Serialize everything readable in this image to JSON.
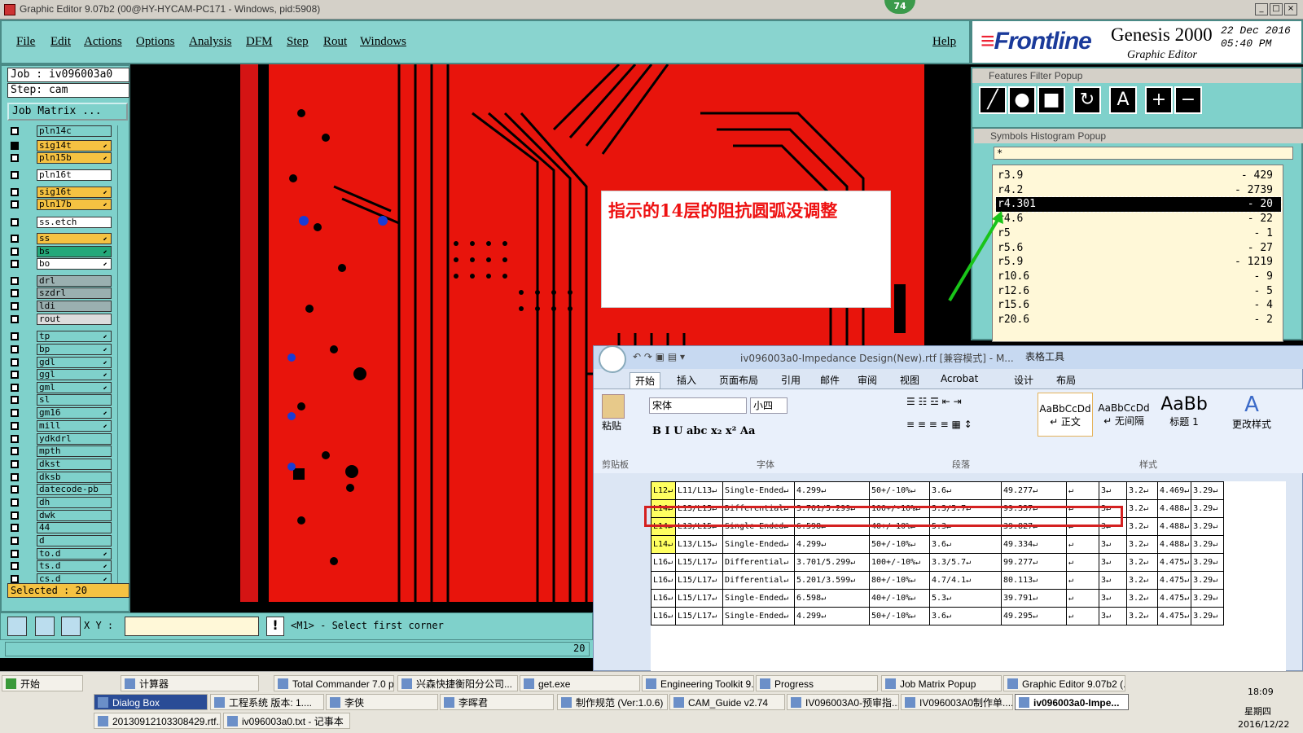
{
  "window": {
    "title": "Graphic Editor 9.07b2 (00@HY-HYCAM-PC171 - Windows, pid:5908)",
    "badge": "74"
  },
  "menu": {
    "items": [
      "File",
      "Edit",
      "Actions",
      "Options",
      "Analysis",
      "DFM",
      "Step",
      "Rout",
      "Windows"
    ],
    "help": "Help"
  },
  "brand": {
    "logo": "Frontline",
    "product": "Genesis 2000",
    "subtitle": "Graphic Editor",
    "date": "22 Dec 2016",
    "time": "05:40 PM"
  },
  "job": {
    "job_label": "Job  :  iv096003a0",
    "step_label": "Step:  cam",
    "matrix_button": "Job Matrix ..."
  },
  "layers": [
    {
      "name": "pln14c",
      "color": "#7fd1cb"
    },
    {
      "name": "sig14t",
      "color": "#f5c242",
      "arrow": true,
      "active": true
    },
    {
      "name": "pln15b",
      "color": "#f5c242",
      "arrow": true
    },
    {
      "name": "pln16t",
      "color": "#ffffff"
    },
    {
      "name": "sig16t",
      "color": "#f5c242",
      "arrow": true
    },
    {
      "name": "pln17b",
      "color": "#f5c242",
      "arrow": true
    },
    {
      "name": "ss.etch",
      "color": "#ffffff"
    },
    {
      "name": "ss",
      "color": "#f5c242",
      "arrow": true
    },
    {
      "name": "bs",
      "color": "#24a87a",
      "arrow": true
    },
    {
      "name": "bo",
      "color": "#ffffff",
      "arrow": true
    },
    {
      "name": "drl",
      "color": "#9ab0b0"
    },
    {
      "name": "szdrl",
      "color": "#9ab0b0"
    },
    {
      "name": "ldi",
      "color": "#9ab0b0"
    },
    {
      "name": "rout",
      "color": "#dddddd"
    },
    {
      "name": "tp",
      "color": "#7fd1cb",
      "arrow": true
    },
    {
      "name": "bp",
      "color": "#7fd1cb",
      "arrow": true
    },
    {
      "name": "gdl",
      "color": "#7fd1cb",
      "arrow": true
    },
    {
      "name": "ggl",
      "color": "#7fd1cb",
      "arrow": true
    },
    {
      "name": "gml",
      "color": "#7fd1cb",
      "arrow": true
    },
    {
      "name": "sl",
      "color": "#7fd1cb"
    },
    {
      "name": "gm16",
      "color": "#7fd1cb",
      "arrow": true
    },
    {
      "name": "mill",
      "color": "#7fd1cb",
      "arrow": true
    },
    {
      "name": "ydkdrl",
      "color": "#7fd1cb"
    },
    {
      "name": "mpth",
      "color": "#7fd1cb"
    },
    {
      "name": "dkst",
      "color": "#7fd1cb"
    },
    {
      "name": "dksb",
      "color": "#7fd1cb"
    },
    {
      "name": "datecode-pb",
      "color": "#7fd1cb"
    },
    {
      "name": "dh",
      "color": "#7fd1cb"
    },
    {
      "name": "dwk",
      "color": "#7fd1cb"
    },
    {
      "name": "44",
      "color": "#7fd1cb"
    },
    {
      "name": "d",
      "color": "#7fd1cb"
    },
    {
      "name": "to.d",
      "color": "#7fd1cb",
      "arrow": true
    },
    {
      "name": "ts.d",
      "color": "#7fd1cb",
      "arrow": true
    },
    {
      "name": "cs.d",
      "color": "#7fd1cb",
      "arrow": true
    }
  ],
  "selected": "Selected : 20",
  "command": {
    "xy_label": "X Y :",
    "prompt": "<M1> - Select first corner",
    "status_count": "20"
  },
  "features_popup": {
    "title": "Features Filter Popup"
  },
  "symbols_popup": {
    "title": "Symbols Histogram Popup",
    "filter": "*",
    "rows": [
      {
        "name": "r3.9",
        "count": "- 429"
      },
      {
        "name": "r4.2",
        "count": "- 2739"
      },
      {
        "name": "r4.301",
        "count": "- 20",
        "selected": true
      },
      {
        "name": "r4.6",
        "count": "- 22"
      },
      {
        "name": "r5",
        "count": "- 1"
      },
      {
        "name": "r5.6",
        "count": "- 27"
      },
      {
        "name": "r5.9",
        "count": "- 1219"
      },
      {
        "name": "r10.6",
        "count": "- 9"
      },
      {
        "name": "r12.6",
        "count": "- 5"
      },
      {
        "name": "r15.6",
        "count": "- 4"
      },
      {
        "name": "r20.6",
        "count": "- 2"
      }
    ]
  },
  "annotation": "指示的14层的阻抗圆弧没调整",
  "word": {
    "title": "iv096003a0-Impedance Design(New).rtf [兼容模式] - M...",
    "context_tab": "表格工具",
    "tabs": [
      "开始",
      "插入",
      "页面布局",
      "引用",
      "邮件",
      "审阅",
      "视图",
      "Acrobat",
      "设计",
      "布局"
    ],
    "font_name": "宋体",
    "font_size": "小四",
    "groups": [
      "剪贴板",
      "字体",
      "段落",
      "样式"
    ],
    "paste": "粘贴",
    "styles": [
      {
        "sample": "AaBbCcDd",
        "label": "↵ 正文"
      },
      {
        "sample": "AaBbCcDd",
        "label": "↵ 无间隔"
      },
      {
        "sample": "AaBb",
        "label": "标题 1"
      }
    ],
    "change_styles": "更改样式",
    "table": [
      [
        "L12↵",
        "L11/L13↵",
        "Single-Ended↵",
        "4.299↵",
        "50+/-10%↵",
        "3.6↵",
        "49.277↵",
        "↵",
        "3↵",
        "3.2↵",
        "4.469↵",
        "3.29↵"
      ],
      [
        "L14↵",
        "L13/L15↵",
        "Differential↵",
        "3.701/5.299↵",
        "100+/-10%↵",
        "3.3/5.7↵",
        "99.337↵",
        "↵",
        "3↵",
        "3.2↵",
        "4.488↵",
        "3.29↵"
      ],
      [
        "L14↵",
        "L13/L15↵",
        "Single-Ended↵",
        "6.598↵",
        "40+/-10%↵",
        "5.3↵",
        "39.827↵",
        "↵",
        "3↵",
        "3.2↵",
        "4.488↵",
        "3.29↵"
      ],
      [
        "L14↵",
        "L13/L15↵",
        "Single-Ended↵",
        "4.299↵",
        "50+/-10%↵",
        "3.6↵",
        "49.334↵",
        "↵",
        "3↵",
        "3.2↵",
        "4.488↵",
        "3.29↵"
      ],
      [
        "L16↵",
        "L15/L17↵",
        "Differential↵",
        "3.701/5.299↵",
        "100+/-10%↵",
        "3.3/5.7↵",
        "99.277↵",
        "↵",
        "3↵",
        "3.2↵",
        "4.475↵",
        "3.29↵"
      ],
      [
        "L16↵",
        "L15/L17↵",
        "Differential↵",
        "5.201/3.599↵",
        "80+/-10%↵",
        "4.7/4.1↵",
        "80.113↵",
        "↵",
        "3↵",
        "3.2↵",
        "4.475↵",
        "3.29↵"
      ],
      [
        "L16↵",
        "L15/L17↵",
        "Single-Ended↵",
        "6.598↵",
        "40+/-10%↵",
        "5.3↵",
        "39.791↵",
        "↵",
        "3↵",
        "3.2↵",
        "4.475↵",
        "3.29↵"
      ],
      [
        "L16↵",
        "L15/L17↵",
        "Single-Ended↵",
        "4.299↵",
        "50+/-10%↵",
        "3.6↵",
        "49.295↵",
        "↵",
        "3↵",
        "3.2↵",
        "4.475↵",
        "3.29↵"
      ]
    ]
  },
  "taskbar": {
    "start": "开始",
    "row1": [
      "计算器",
      "Total Commander 7.0 p...",
      "兴森快捷衡阳分公司...",
      "get.exe",
      "Engineering Toolkit 9.0...",
      "Progress",
      "Job Matrix Popup",
      "Graphic Editor 9.07b2 (..."
    ],
    "row2": [
      "Dialog Box",
      "工程系统  版本: 1....",
      "李侠",
      "李晖君",
      "制作规范 (Ver:1.0.6)",
      "CAM_Guide v2.74",
      "IV096003A0-预审指...",
      "IV096003A0制作单....",
      "iv096003a0-Impe..."
    ],
    "row3": [
      "20130912103308429.rtf...",
      "iv096003a0.txt - 记事本"
    ],
    "clock": {
      "time": "18:09",
      "weekday": "星期四",
      "date": "2016/12/22"
    }
  }
}
